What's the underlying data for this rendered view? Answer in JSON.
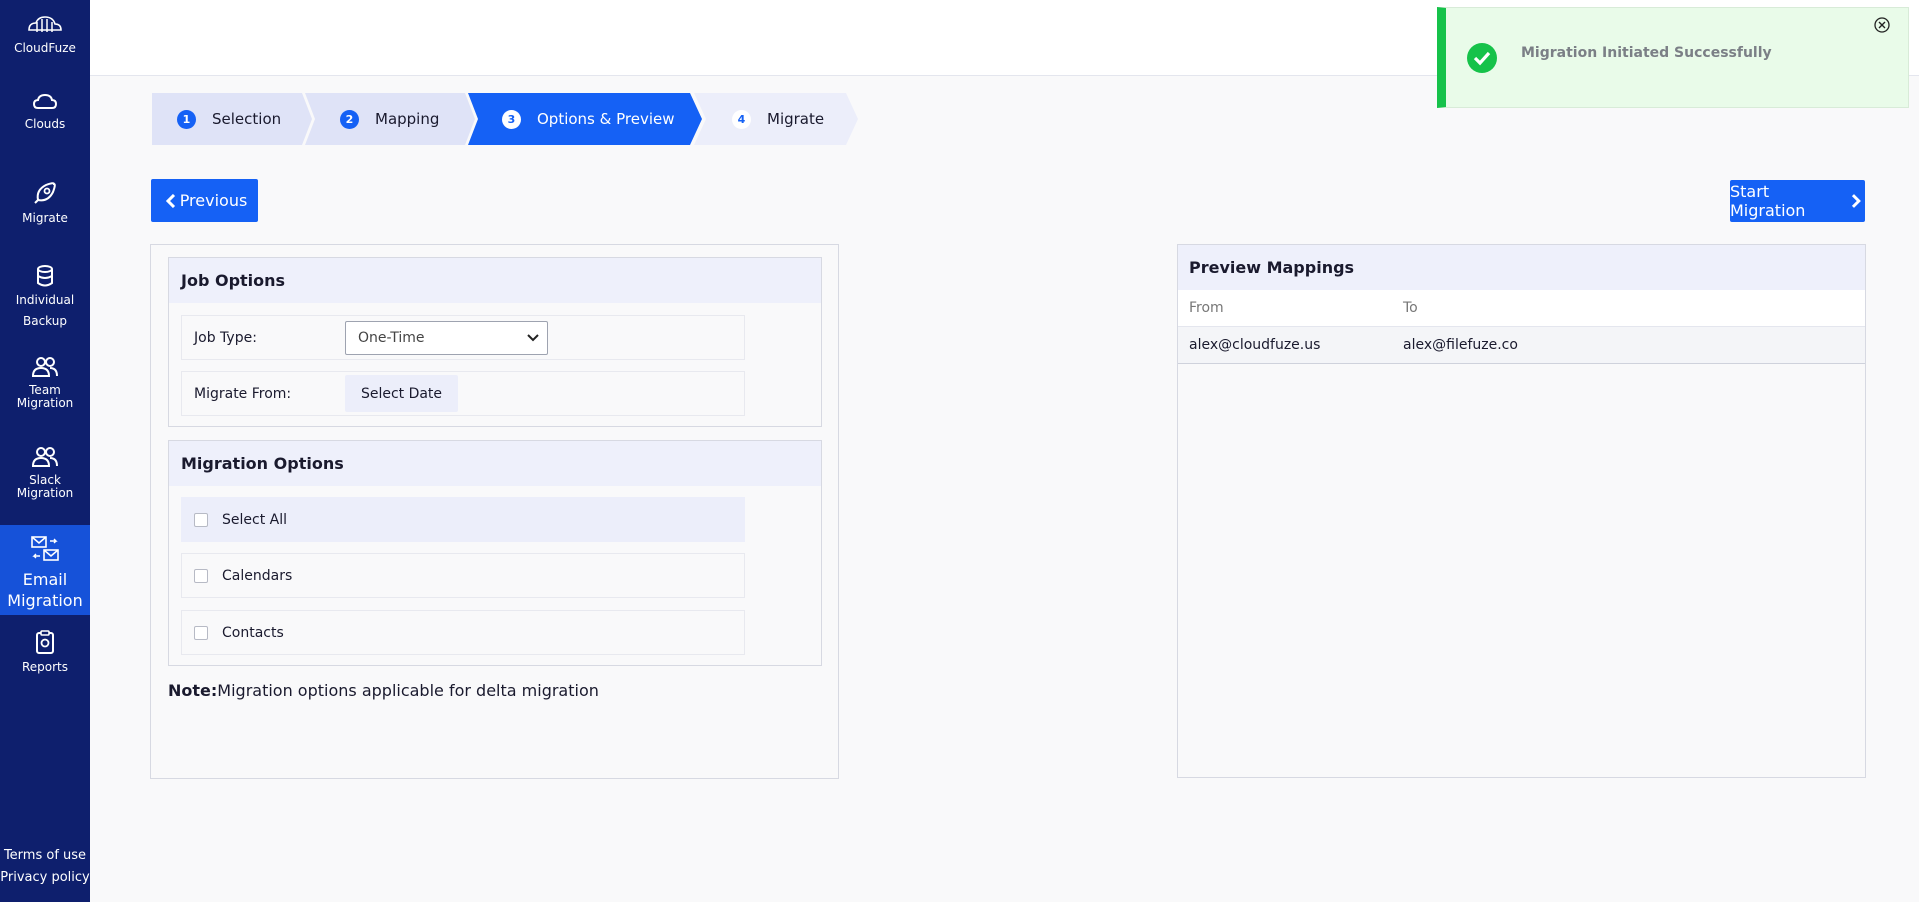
{
  "sidebar": {
    "brand": "CloudFuze",
    "items": [
      {
        "label": "Clouds"
      },
      {
        "label": "Migrate"
      },
      {
        "label_line1": "Individual",
        "label_line2": "Backup"
      },
      {
        "label_line1": "Team",
        "label_line2": "Migration"
      },
      {
        "label_line1": "Slack",
        "label_line2": "Migration"
      },
      {
        "label_line1": "Email",
        "label_line2": "Migration"
      },
      {
        "label": "Reports"
      }
    ],
    "footer": {
      "terms": "Terms of use",
      "privacy": "Privacy policy"
    }
  },
  "stepper": [
    {
      "num": "1",
      "label": "Selection"
    },
    {
      "num": "2",
      "label": "Mapping"
    },
    {
      "num": "3",
      "label": "Options & Preview"
    },
    {
      "num": "4",
      "label": "Migrate"
    }
  ],
  "buttons": {
    "previous": "Previous",
    "start": "Start Migration"
  },
  "job_options": {
    "title": "Job Options",
    "job_type_label": "Job Type:",
    "job_type_value": "One-Time",
    "migrate_from_label": "Migrate From:",
    "select_date": "Select Date"
  },
  "migration_options": {
    "title": "Migration Options",
    "items": [
      "Select All",
      "Calendars",
      "Contacts"
    ]
  },
  "note": {
    "prefix": "Note:",
    "text": "Migration options applicable for delta migration"
  },
  "preview": {
    "title": "Preview Mappings",
    "col_from": "From",
    "col_to": "To",
    "rows": [
      {
        "from": "alex@cloudfuze.us",
        "to": "alex@filefuze.co"
      }
    ]
  },
  "toast": {
    "message": "Migration Initiated Successfully"
  },
  "colors": {
    "sidebar": "#0e1f6d",
    "accent": "#1561f5",
    "success": "#16c24a"
  }
}
